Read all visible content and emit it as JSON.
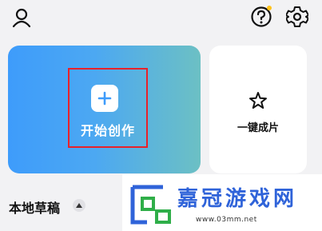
{
  "create_card": {
    "label": "开始创作"
  },
  "oneclick_card": {
    "label": "一键成片"
  },
  "drafts": {
    "title": "本地草稿"
  },
  "watermark": {
    "title": "嘉冠游戏网",
    "url": "www.03mm.net"
  },
  "colors": {
    "gradient_start": "#3e9cfb",
    "gradient_end": "#6cc0c4",
    "highlight": "#e8212a",
    "notification_dot": "#ffc21a",
    "watermark_blue": "#2f63d9"
  },
  "icons": [
    "user-icon",
    "help-icon",
    "gear-icon",
    "plus-icon",
    "star-icon",
    "caret-up-icon"
  ]
}
